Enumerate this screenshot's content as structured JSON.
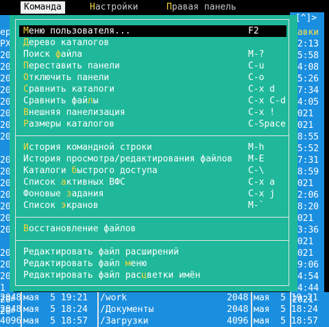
{
  "menubar": {
    "items": [
      {
        "hot": "К",
        "rest": "оманда",
        "active": true
      },
      {
        "hot": "Н",
        "rest": "астройки",
        "active": false
      },
      {
        "hot": "П",
        "rest": "равая панель",
        "active": false
      }
    ]
  },
  "right_panel_header": ".[^]>",
  "dropdown": {
    "groups": [
      [
        {
          "pre": "",
          "hot": "М",
          "post": "еню пользователя...",
          "key": "F2",
          "selected": true
        },
        {
          "pre": "",
          "hot": "Д",
          "post": "ерево каталогов",
          "key": ""
        },
        {
          "pre": "Поиск ",
          "hot": "ф",
          "post": "айла",
          "key": "M-?"
        },
        {
          "pre": "",
          "hot": "П",
          "post": "ереставить панели",
          "key": "C-u"
        },
        {
          "pre": "",
          "hot": "О",
          "post": "тключить панели",
          "key": "C-o"
        },
        {
          "pre": "",
          "hot": "С",
          "post": "равнить каталоги",
          "key": "C-x d"
        },
        {
          "pre": "Сравнить фай",
          "hot": "л",
          "post": "ы",
          "key": "C-x C-d"
        },
        {
          "pre": "",
          "hot": "В",
          "post": "нешняя панелизация",
          "key": "C-x !"
        },
        {
          "pre": "",
          "hot": "Р",
          "post": "азмеры каталогов",
          "key": "C-Space"
        }
      ],
      [
        {
          "pre": "",
          "hot": "И",
          "post": "стория командной строки",
          "key": "M-h"
        },
        {
          "pre": "История просмотра/редактирования файлов",
          "hot": "",
          "post": "",
          "key": "M-E"
        },
        {
          "pre": "Каталоги ",
          "hot": "б",
          "post": "ыстрого доступа",
          "key": "C-\\"
        },
        {
          "pre": "Список ",
          "hot": "а",
          "post": "ктивных ВФС",
          "key": "C-x a"
        },
        {
          "pre": "Фоновые ",
          "hot": "з",
          "post": "адания",
          "key": "C-x j"
        },
        {
          "pre": "Список ",
          "hot": "э",
          "post": "кранов",
          "key": "M-`"
        }
      ],
      [
        {
          "pre": "",
          "hot": "В",
          "post": "осстановление файлов",
          "key": ""
        }
      ],
      [
        {
          "pre": "Редактировать файл расширений",
          "hot": "",
          "post": "",
          "key": ""
        },
        {
          "pre": "Редактировать файл ",
          "hot": "м",
          "post": "еню",
          "key": ""
        },
        {
          "pre": "Редактировать файл рас",
          "hot": "ц",
          "post": "ветки имён",
          "key": ""
        }
      ]
    ]
  },
  "left_fragments": [
    "ер",
    "РХ",
    "204",
    "204",
    "204",
    "204",
    "204",
    "204",
    "204",
    "204",
    "",
    "204",
    "204",
    "204",
    "204",
    "204",
    "204",
    "204",
    "",
    "204",
    "204",
    "204",
    "1",
    "204",
    "204"
  ],
  "right_fragments": [
    {
      "t": "равки",
      "y": true
    },
    {
      "t": "12:13"
    },
    {
      "t": "15:58"
    },
    {
      "t": "14:08"
    },
    {
      "t": "15:26"
    },
    {
      "t": "17:34"
    },
    {
      "t": "14:05"
    },
    {
      "t": "2021"
    },
    {
      "t": "2021"
    },
    {
      "t": "18:55"
    },
    {
      "t": "15:52"
    },
    {
      "t": "17:31"
    },
    {
      "t": "18:59"
    },
    {
      "t": "2021"
    },
    {
      "t": "12:06"
    },
    {
      "t": "18:20"
    },
    {
      "t": "2021"
    },
    {
      "t": "13:36"
    },
    {
      "t": "2021"
    },
    {
      "t": "2021"
    },
    {
      "t": "19:06"
    },
    {
      "t": "14:54"
    },
    {
      "t": "14:44"
    },
    {
      "t": "2021"
    }
  ],
  "bottom_lines": [
    {
      "left": "2048",
      "date1": "мая  5 19:21",
      "name": "/work",
      "size": "2048",
      "date2": "мая  5 19:21"
    },
    {
      "left": "2048",
      "date1": "мая  5 18:24",
      "name": "/Документы",
      "size": "2048",
      "date2": "мая  5 18:24"
    },
    {
      "left": "4096",
      "date1": "мая  5 18:57",
      "name": "/Загрузки",
      "size": "4096",
      "date2": "мая  5 18:57"
    }
  ]
}
